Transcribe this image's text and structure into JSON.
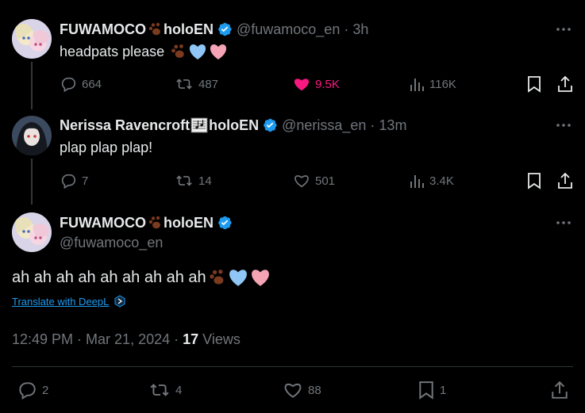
{
  "tweets": [
    {
      "name": "FUWAMOCO",
      "name_suffix": "holoEN",
      "name_emoji": "paw-emoji",
      "handle": "@fuwamoco_en",
      "time": "3h",
      "text": "headpats please",
      "text_emojis": [
        "paw-emoji",
        "blue-heart-emoji",
        "pink-heart-emoji"
      ],
      "replies": "664",
      "reposts": "487",
      "likes": "9.5K",
      "liked": true,
      "views": "116K"
    },
    {
      "name": "Nerissa Ravencroft",
      "name_suffix": "holoEN",
      "name_emoji": "sheet-music-emoji",
      "handle": "@nerissa_en",
      "time": "13m",
      "text": "plap plap plap!",
      "replies": "7",
      "reposts": "14",
      "likes": "501",
      "liked": false,
      "views": "3.4K"
    }
  ],
  "focused": {
    "name": "FUWAMOCO",
    "name_suffix": "holoEN",
    "handle": "@fuwamoco_en",
    "text": "ah ah ah ah ah ah ah ah ah",
    "text_emojis": [
      "paw-emoji",
      "blue-heart-emoji",
      "pink-heart-emoji"
    ],
    "translate_label": "Translate with DeepL",
    "timestamp": "12:49 PM · Mar 21, 2024",
    "views_count": "17",
    "views_label": "Views",
    "replies": "2",
    "reposts": "4",
    "likes": "88",
    "bookmarks": "1"
  },
  "colors": {
    "background": "#000000",
    "text": "#e7e9ea",
    "muted": "#71767b",
    "like_pink": "#f91880",
    "verified_blue": "#1d9bf0",
    "divider": "#2f3336"
  }
}
